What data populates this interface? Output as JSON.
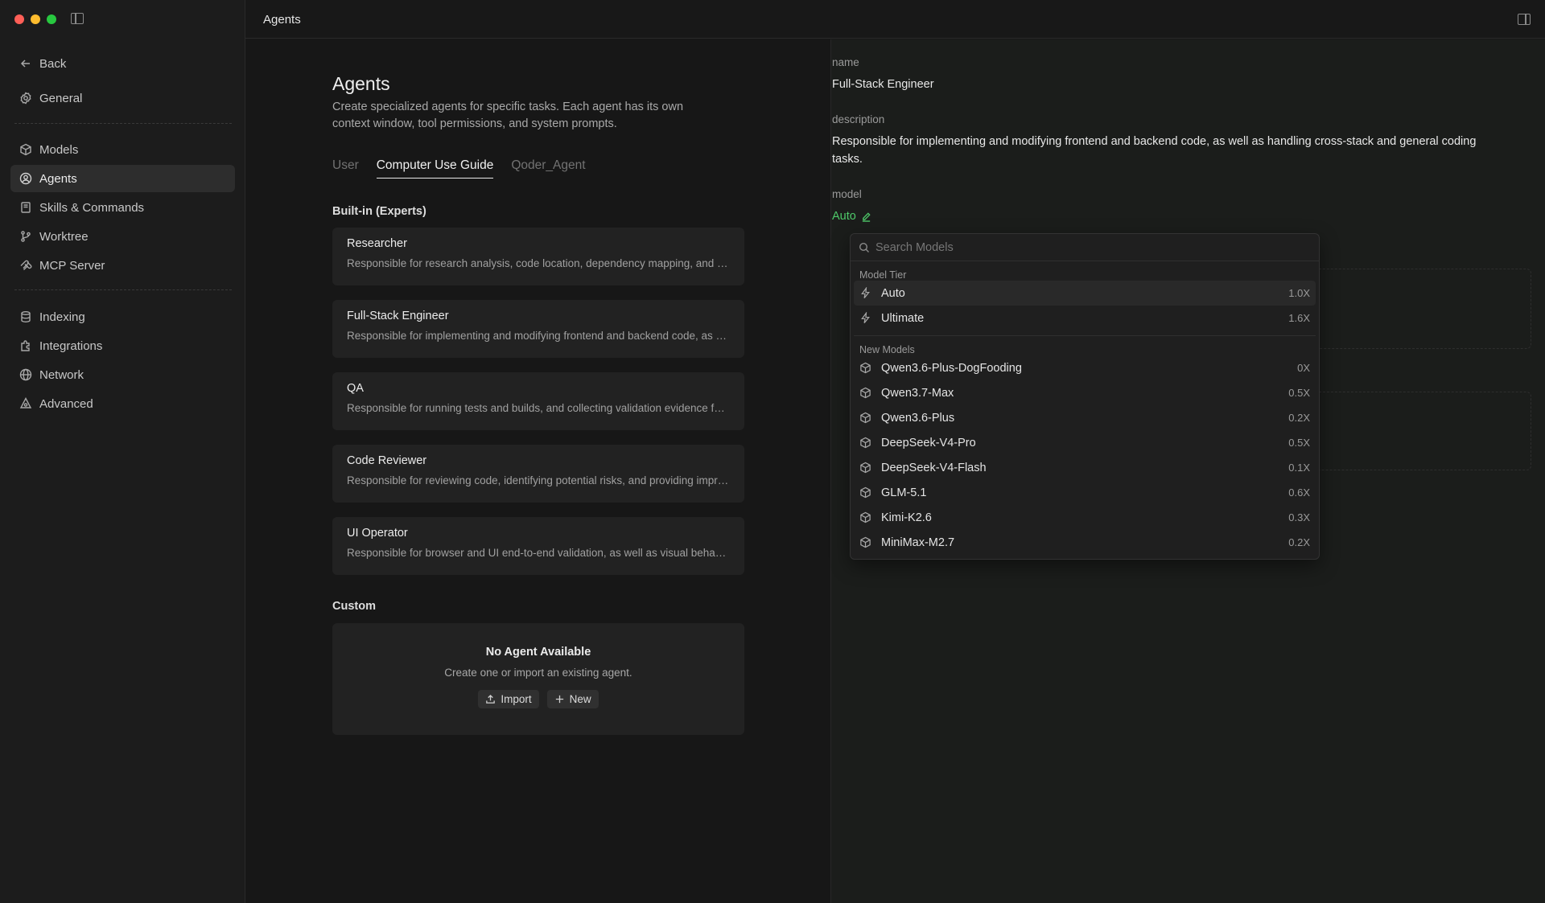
{
  "window": {
    "title": "Agents"
  },
  "colors": {
    "accent_green": "#4ec969",
    "traffic_red": "#ff5f57",
    "traffic_yellow": "#febc2e",
    "traffic_green": "#28c840"
  },
  "sidebar": {
    "back_label": "Back",
    "items": [
      {
        "label": "General",
        "icon": "gear-icon"
      },
      {
        "label": "Models",
        "icon": "cube-icon"
      },
      {
        "label": "Agents",
        "icon": "user-circle-icon"
      },
      {
        "label": "Skills & Commands",
        "icon": "book-icon"
      },
      {
        "label": "Worktree",
        "icon": "git-branch-icon"
      },
      {
        "label": "MCP Server",
        "icon": "mcp-icon"
      },
      {
        "label": "Indexing",
        "icon": "database-icon"
      },
      {
        "label": "Integrations",
        "icon": "puzzle-icon"
      },
      {
        "label": "Network",
        "icon": "globe-icon"
      },
      {
        "label": "Advanced",
        "icon": "advanced-icon"
      }
    ],
    "active": "Agents"
  },
  "page": {
    "title": "Agents",
    "description": "Create specialized agents for specific tasks. Each agent has its own context window, tool permissions, and system prompts.",
    "tabs": [
      "User",
      "Computer Use Guide",
      "Qoder_Agent"
    ],
    "active_tab": "Computer Use Guide",
    "builtin_title": "Built-in (Experts)",
    "builtin": [
      {
        "name": "Researcher",
        "desc": "Responsible for research analysis, code location, dependency mapping, and information gathering tasks."
      },
      {
        "name": "Full-Stack Engineer",
        "desc": "Responsible for implementing and modifying frontend and backend code, as well as handling cross-stack and general coding tasks."
      },
      {
        "name": "QA",
        "desc": "Responsible for running tests and builds, and collecting validation evidence for changes."
      },
      {
        "name": "Code Reviewer",
        "desc": "Responsible for reviewing code, identifying potential risks, and providing improvement suggestions."
      },
      {
        "name": "UI Operator",
        "desc": "Responsible for browser and UI end-to-end validation, as well as visual behavior checks."
      }
    ],
    "custom_title": "Custom",
    "custom_empty": {
      "title": "No Agent Available",
      "desc": "Create one or import an existing agent.",
      "import_label": "Import",
      "new_label": "New"
    }
  },
  "detail": {
    "name_label": "name",
    "name_value": "Full-Stack Engineer",
    "description_label": "description",
    "description_value": "Responsible for implementing and modifying frontend and backend code, as well as handling cross-stack and general coding tasks.",
    "model_label": "model",
    "model_value": "Auto"
  },
  "model_dropdown": {
    "search_placeholder": "Search Models",
    "tier_group": "Model Tier",
    "tiers": [
      {
        "name": "Auto",
        "mult": "1.0X"
      },
      {
        "name": "Ultimate",
        "mult": "1.6X"
      }
    ],
    "new_group": "New Models",
    "models": [
      {
        "name": "Qwen3.6-Plus-DogFooding",
        "mult": "0X"
      },
      {
        "name": "Qwen3.7-Max",
        "mult": "0.5X"
      },
      {
        "name": "Qwen3.6-Plus",
        "mult": "0.2X"
      },
      {
        "name": "DeepSeek-V4-Pro",
        "mult": "0.5X"
      },
      {
        "name": "DeepSeek-V4-Flash",
        "mult": "0.1X"
      },
      {
        "name": "GLM-5.1",
        "mult": "0.6X"
      },
      {
        "name": "Kimi-K2.6",
        "mult": "0.3X"
      },
      {
        "name": "MiniMax-M2.7",
        "mult": "0.2X"
      }
    ]
  }
}
